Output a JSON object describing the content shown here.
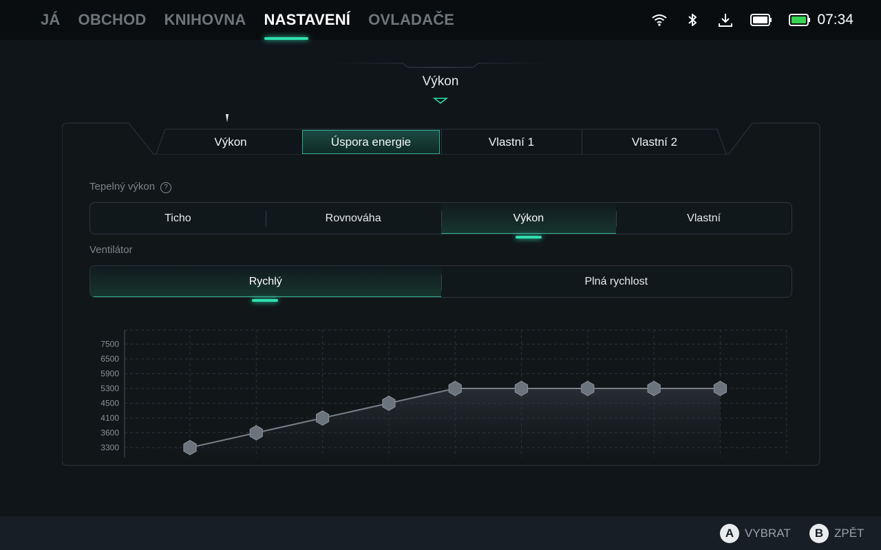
{
  "nav": {
    "items": [
      {
        "label": "JÁ"
      },
      {
        "label": "OBCHOD"
      },
      {
        "label": "KNIHOVNA"
      },
      {
        "label": "NASTAVENÍ",
        "active": true
      },
      {
        "label": "OVLADAČE"
      }
    ],
    "active_color": "#2fe0ae"
  },
  "status": {
    "icons": [
      "wifi-icon",
      "bluetooth-icon",
      "download-icon",
      "controller-battery-icon",
      "battery-icon"
    ],
    "battery_color": "#39d353",
    "time": "07:34"
  },
  "section": {
    "title": "Výkon"
  },
  "profile_tabs": [
    {
      "label": "Výkon"
    },
    {
      "label": "Úspora energie",
      "selected": true
    },
    {
      "label": "Vlastní 1"
    },
    {
      "label": "Vlastní 2"
    }
  ],
  "thermal": {
    "label": "Tepelný výkon",
    "help": "?",
    "options": [
      {
        "label": "Ticho"
      },
      {
        "label": "Rovnováha"
      },
      {
        "label": "Výkon",
        "selected": true
      },
      {
        "label": "Vlastní"
      }
    ]
  },
  "fan": {
    "label": "Ventilátor",
    "options": [
      {
        "label": "Rychlý",
        "selected": true
      },
      {
        "label": "Plná rychlost"
      }
    ]
  },
  "chart_data": {
    "type": "line",
    "y_ticks": [
      3300,
      3600,
      4100,
      4500,
      5300,
      5900,
      6500,
      7500
    ],
    "points": [
      3300,
      3600,
      4100,
      4500,
      5300,
      5300,
      5300,
      5300,
      5300
    ],
    "grid": true,
    "line_color": "#7a8088",
    "marker_color": "#6b737d"
  },
  "hints": [
    {
      "button": "A",
      "label": "VYBRAT"
    },
    {
      "button": "B",
      "label": "ZPĚT"
    }
  ]
}
